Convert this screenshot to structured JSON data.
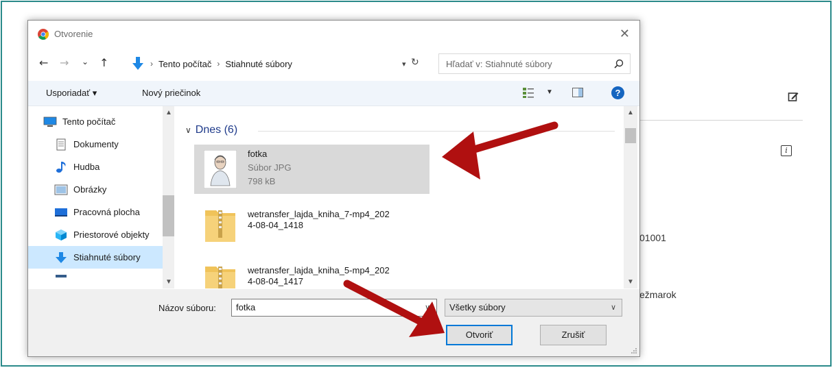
{
  "dialog": {
    "title": "Otvorenie",
    "close_glyph": "✕",
    "nav": {
      "back": "←",
      "forward": "→",
      "recent": "⌄",
      "up": "↑",
      "breadcrumb": [
        "Tento počítač",
        "Stiahnuté súbory"
      ],
      "separator": "›",
      "refresh": "↻",
      "search_placeholder": "Hľadať v: Stiahnuté súbory"
    },
    "toolbar": {
      "organize": "Usporiadať ▾",
      "new_folder": "Nový priečinok",
      "help": "?"
    },
    "sidebar": {
      "items": [
        {
          "label": "Tento počítač",
          "icon": "computer-icon"
        },
        {
          "label": "Dokumenty",
          "icon": "documents-icon"
        },
        {
          "label": "Hudba",
          "icon": "music-icon"
        },
        {
          "label": "Obrázky",
          "icon": "pictures-icon"
        },
        {
          "label": "Pracovná plocha",
          "icon": "desktop-icon"
        },
        {
          "label": "Priestorové objekty",
          "icon": "3d-objects-icon"
        },
        {
          "label": "Stiahnuté súbory",
          "icon": "downloads-icon",
          "selected": true
        }
      ]
    },
    "files": {
      "group": "Dnes (6)",
      "items": [
        {
          "name": "fotka",
          "type": "Súbor JPG",
          "size": "798 kB",
          "icon": "image-thumbnail",
          "selected": true
        },
        {
          "name": "wetransfer_lajda_kniha_7-mp4_202\n4-08-04_1418",
          "icon": "zip-folder-icon"
        },
        {
          "name": "wetransfer_lajda_kniha_5-mp4_202\n4-08-04_1417",
          "icon": "zip-folder-icon"
        }
      ]
    },
    "bottom": {
      "filename_label": "Názov súboru:",
      "filename_value": "fotka",
      "filetype_value": "Všetky súbory",
      "open_button": "Otvoriť",
      "cancel_button": "Zrušiť"
    }
  },
  "background_page": {
    "text_1": "01001",
    "text_2": "ežmarok",
    "info_glyph": "i"
  },
  "colors": {
    "frame_border": "#2a8a8a",
    "selection": "#cce8ff",
    "accent": "#0078d7",
    "annotation_arrow": "#b01010"
  }
}
